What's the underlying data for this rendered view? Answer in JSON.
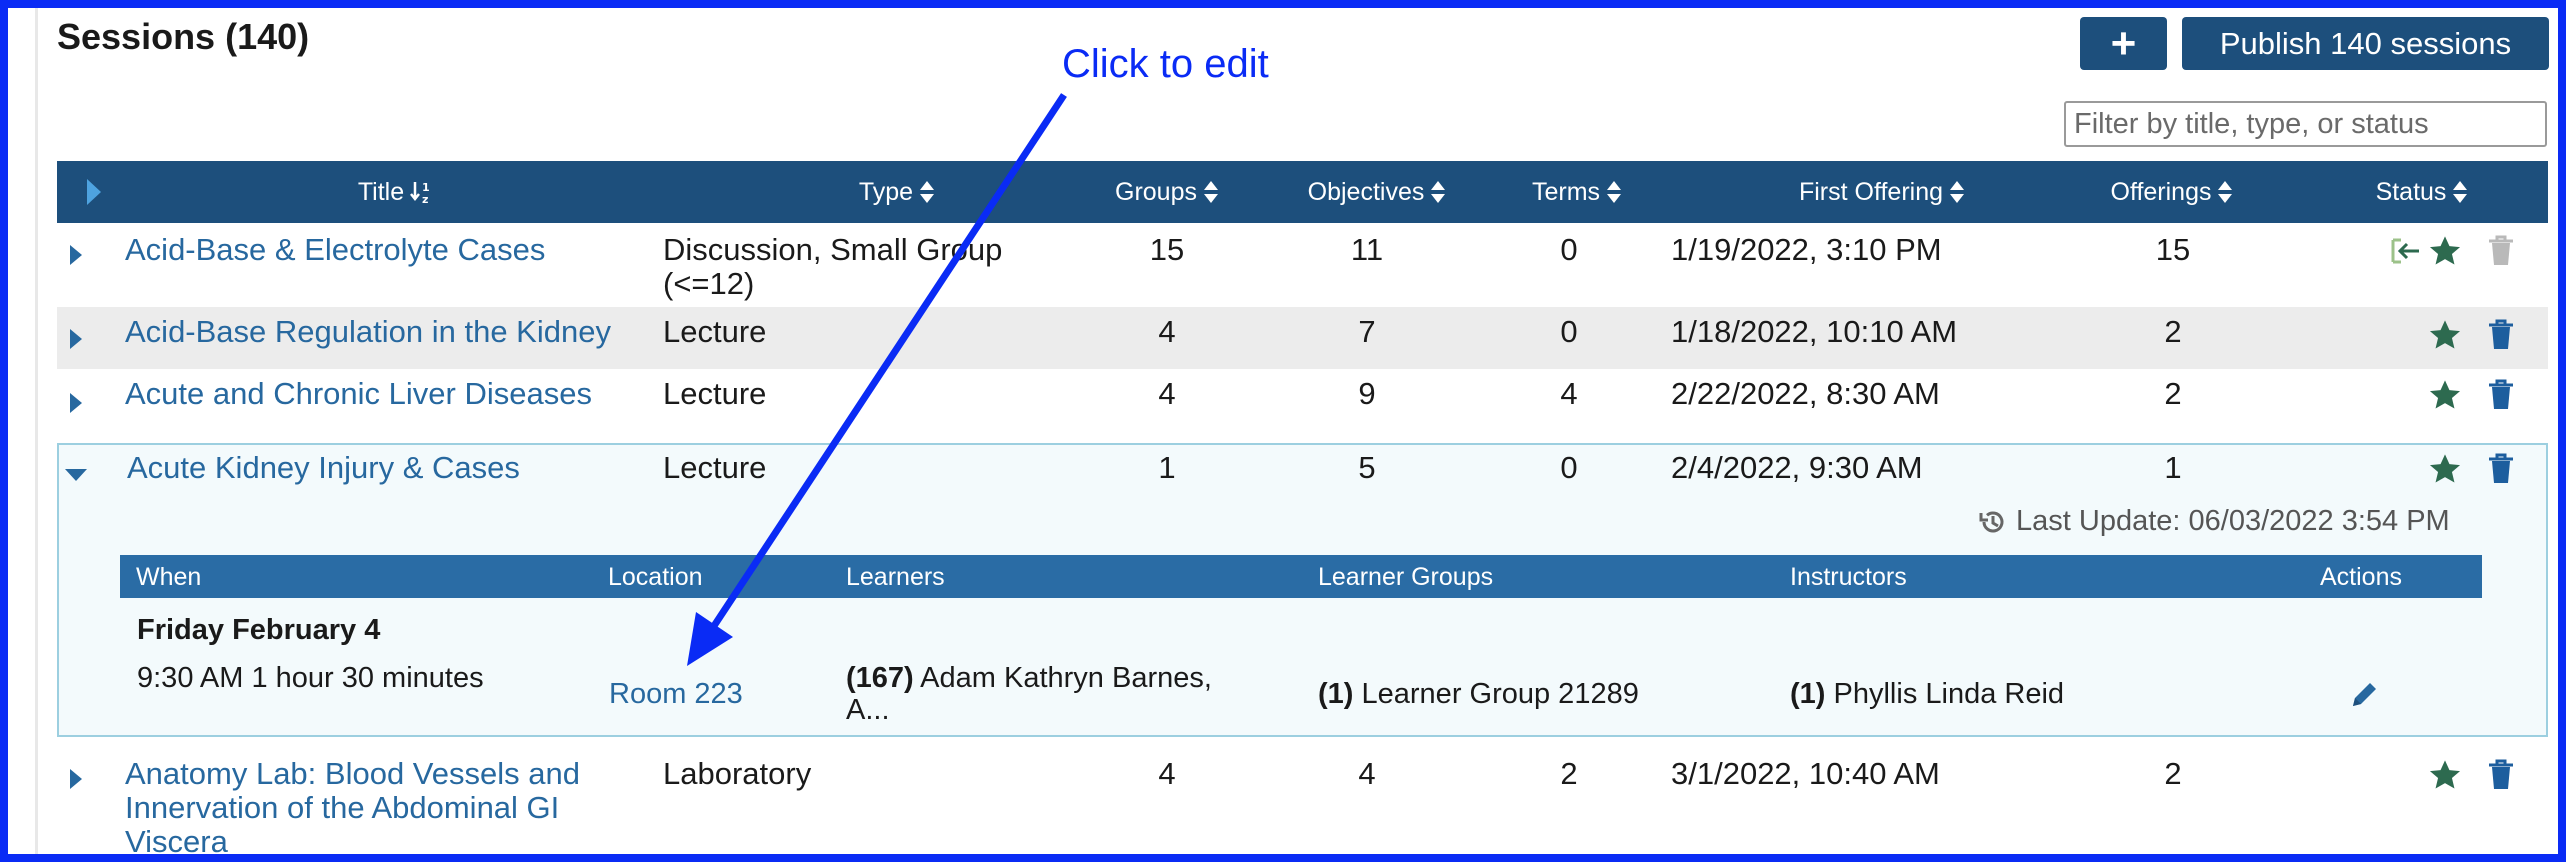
{
  "page": {
    "title": "Sessions (140)"
  },
  "toolbar": {
    "add_label": "+",
    "publish_label": "Publish 140 sessions"
  },
  "filter": {
    "placeholder": "Filter by title, type, or status",
    "value": ""
  },
  "annotation": {
    "text": "Click to edit"
  },
  "table": {
    "headers": {
      "title": "Title",
      "type": "Type",
      "groups": "Groups",
      "objectives": "Objectives",
      "terms": "Terms",
      "first_offering": "First Offering",
      "offerings": "Offerings",
      "status": "Status"
    },
    "rows": [
      {
        "title": "Acid-Base & Electrolyte Cases",
        "type": "Discussion, Small Group (<=12)",
        "groups": "15",
        "objectives": "11",
        "terms": "0",
        "first_offering": "1/19/2022, 3:10 PM",
        "offerings": "15"
      },
      {
        "title": "Acid-Base Regulation in the Kidney",
        "type": "Lecture",
        "groups": "4",
        "objectives": "7",
        "terms": "0",
        "first_offering": "1/18/2022, 10:10 AM",
        "offerings": "2"
      },
      {
        "title": "Acute and Chronic Liver Diseases",
        "type": "Lecture",
        "groups": "4",
        "objectives": "9",
        "terms": "4",
        "first_offering": "2/22/2022, 8:30 AM",
        "offerings": "2"
      },
      {
        "title": "Acute Kidney Injury & Cases",
        "type": "Lecture",
        "groups": "1",
        "objectives": "5",
        "terms": "0",
        "first_offering": "2/4/2022, 9:30 AM",
        "offerings": "1"
      },
      {
        "title_line1": "Anatomy Lab: Blood Vessels and",
        "title_line2": "Innervation of the Abdominal GI",
        "title_line3": "Viscera",
        "type": "Laboratory",
        "groups": "4",
        "objectives": "4",
        "terms": "2",
        "first_offering": "3/1/2022, 10:40 AM",
        "offerings": "2"
      }
    ]
  },
  "expanded": {
    "last_update": "Last Update: 06/03/2022 3:54 PM",
    "headers": {
      "when": "When",
      "location": "Location",
      "learners": "Learners",
      "learner_groups": "Learner Groups",
      "instructors": "Instructors",
      "actions": "Actions"
    },
    "offering": {
      "date": "Friday February 4",
      "time": "9:30 AM 1 hour 30 minutes",
      "location": "Room 223",
      "learners_count": "(167)",
      "learners_line1": "Adam Kathryn Barnes,",
      "learners_line2": "A...",
      "groups_count": "(1)",
      "groups_name": "Learner Group 21289",
      "instructors_count": "(1)",
      "instructors_name": "Phyllis Linda Reid"
    }
  },
  "colors": {
    "header_bg": "#1d4f7c",
    "link": "#27689f",
    "annotation": "#0a2bf5",
    "star": "#2d6a4f"
  }
}
